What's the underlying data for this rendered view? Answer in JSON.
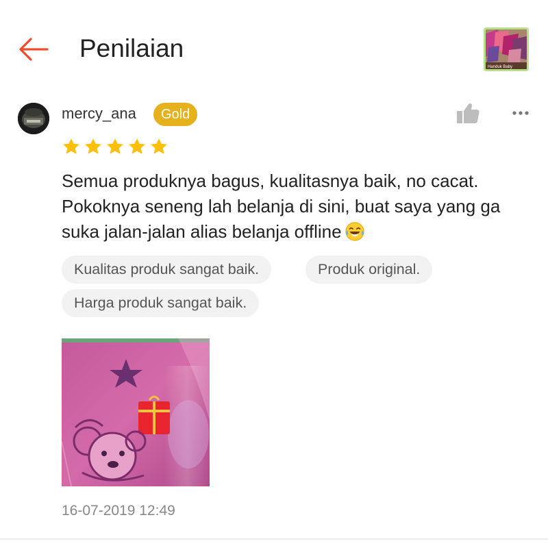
{
  "header": {
    "title": "Penilaian",
    "back_icon": "arrow-left-icon",
    "accent_color": "#ee4d2d",
    "shop_thumbnail_caption": "Handuk Baby"
  },
  "review": {
    "username": "mercy_ana",
    "badge": "Gold",
    "badge_color": "#e5b21d",
    "rating": 5,
    "rating_max": 5,
    "star_color": "#ffc107",
    "text": "Semua produknya bagus, kualitasnya baik, no cacat. Pokoknya seneng lah belanja di sini, buat saya yang ga suka jalan-jalan alias belanja offline",
    "emoji": "face-with-tears-of-joy",
    "tags": [
      "Kualitas produk sangat baik.",
      "Produk original.",
      "Harga produk sangat baik."
    ],
    "timestamp": "16-07-2019 12:49",
    "like_icon": "thumbs-up-icon",
    "more_icon": "more-dots-icon"
  }
}
